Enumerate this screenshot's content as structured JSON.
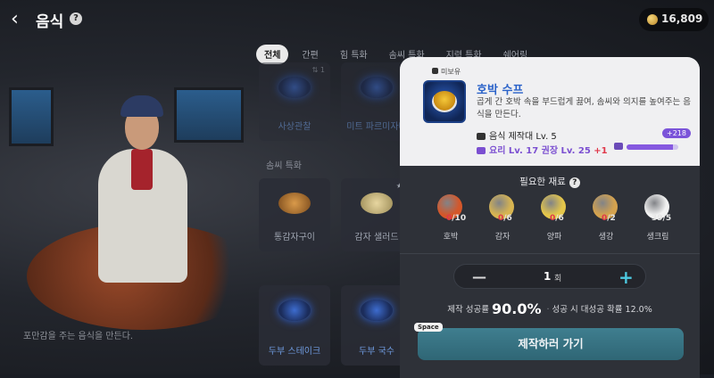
{
  "header": {
    "title": "음식",
    "currency_value": "16,809"
  },
  "tabs": [
    "전체",
    "간편",
    "힘 특화",
    "솜씨 특화",
    "지력 특화",
    "쉐어링"
  ],
  "recipes": {
    "section_label": "솜씨 특화",
    "top_badge": "⇅ 1",
    "items": [
      {
        "label": "사상관찰"
      },
      {
        "label": "미트 파르미자나"
      },
      {
        "label": "통감자구이"
      },
      {
        "label": "감자 샐러드",
        "badge": "★1"
      },
      {
        "label": "두부 스테이크"
      },
      {
        "label": "두부 국수"
      }
    ]
  },
  "footnote": "포만감을 주는 음식을 만든다.",
  "detail": {
    "own_tag": "미보유",
    "name": "호박 수프",
    "description": "곱게 간 호박 속을 부드럽게 끓여, 솜씨와 의지를 높여주는 음식을 만든다.",
    "requirement": "음식 제작대 Lv. 5",
    "skill_text": "요리 Lv. 17",
    "rec_text": "권장 Lv. 25",
    "rec_delta": "+1",
    "exp_gain": "+218",
    "exp_progress": 0.9,
    "materials_title": "필요한 재료",
    "materials": [
      {
        "name": "호박",
        "have": "0",
        "need": "/10",
        "color": "#d4572a"
      },
      {
        "name": "감자",
        "have": "0",
        "need": "/6",
        "color": "#d7b451"
      },
      {
        "name": "양파",
        "have": "0",
        "need": "/6",
        "color": "#e4c64a"
      },
      {
        "name": "생강",
        "have": "0",
        "need": "/2",
        "color": "#d4a24e"
      },
      {
        "name": "생크림",
        "have": "39",
        "need": "/5",
        "color": "#f2f2f2"
      }
    ],
    "quantity": "1",
    "quantity_unit": "회",
    "success_label": "제작 성공률",
    "success_rate": "90.0%",
    "great_label": "성공 시 대성공 확률",
    "great_rate": "12.0%",
    "hotkey": "Space",
    "craft_label": "제작하러 가기"
  }
}
